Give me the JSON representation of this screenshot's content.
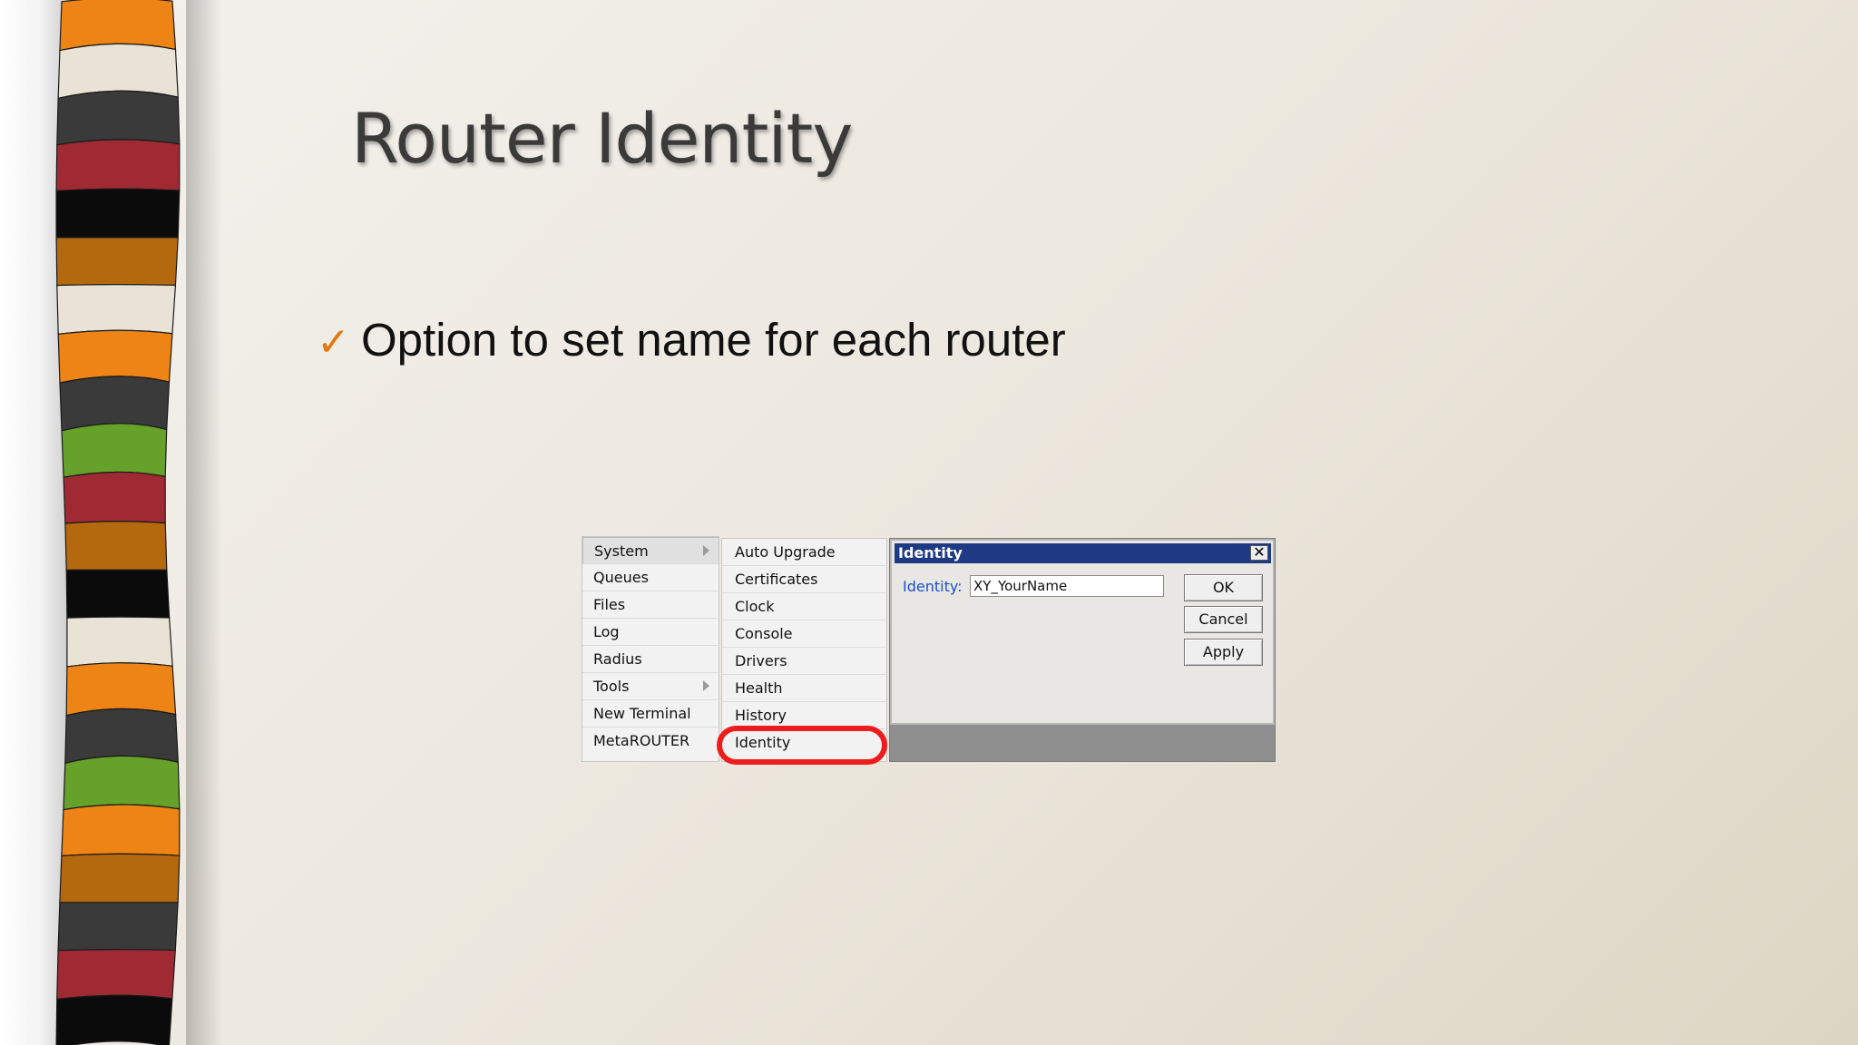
{
  "slide": {
    "title": "Router Identity",
    "bullet_text": "Option to set name for each router",
    "bullet_mark": "✓",
    "check_color": "#e07a10"
  },
  "main_menu": {
    "items": [
      {
        "label": "System",
        "has_submenu": true
      },
      {
        "label": "Queues",
        "has_submenu": false
      },
      {
        "label": "Files",
        "has_submenu": false
      },
      {
        "label": "Log",
        "has_submenu": false
      },
      {
        "label": "Radius",
        "has_submenu": false
      },
      {
        "label": "Tools",
        "has_submenu": true
      },
      {
        "label": "New Terminal",
        "has_submenu": false
      },
      {
        "label": "MetaROUTER",
        "has_submenu": false
      }
    ]
  },
  "system_submenu": {
    "items": [
      {
        "label": "Auto Upgrade"
      },
      {
        "label": "Certificates"
      },
      {
        "label": "Clock"
      },
      {
        "label": "Console"
      },
      {
        "label": "Drivers"
      },
      {
        "label": "Health"
      },
      {
        "label": "History"
      },
      {
        "label": "Identity",
        "highlighted": true
      }
    ],
    "highlight_color": "#ee1c1c"
  },
  "identity_dialog": {
    "title": "Identity",
    "close_symbol": "✕",
    "field_label": "Identity:",
    "field_value": "XY_YourName",
    "buttons": {
      "ok": "OK",
      "cancel": "Cancel",
      "apply": "Apply"
    },
    "titlebar_color": "#1f3a84"
  },
  "decor": {
    "stripe_colors": [
      "#ee8416",
      "#e8e3d5",
      "#3a3a3a",
      "#a02a34",
      "#0b0b0b",
      "#b4690f",
      "#e8e3d5",
      "#ee8416",
      "#3a3a3a",
      "#66a12a",
      "#a02a34",
      "#b4690f",
      "#0b0b0b",
      "#e8e3d5",
      "#ee8416",
      "#3a3a3a",
      "#66a12a",
      "#ee8416",
      "#b4690f",
      "#3a3a3a",
      "#a02a34",
      "#0b0b0b"
    ]
  }
}
